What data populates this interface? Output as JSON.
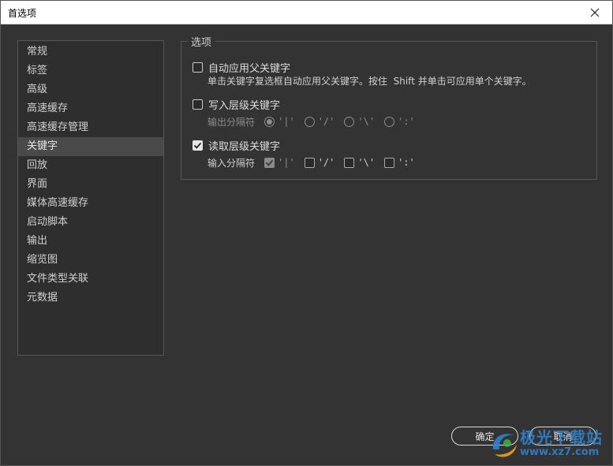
{
  "window": {
    "title": "首选项",
    "close_icon": "close-icon"
  },
  "sidebar": {
    "items": [
      {
        "label": "常规"
      },
      {
        "label": "标签"
      },
      {
        "label": "高级"
      },
      {
        "label": "高速缓存"
      },
      {
        "label": "高速缓存管理"
      },
      {
        "label": "关键字",
        "selected": true
      },
      {
        "label": "回放"
      },
      {
        "label": "界面"
      },
      {
        "label": "媒体高速缓存"
      },
      {
        "label": "启动脚本"
      },
      {
        "label": "输出"
      },
      {
        "label": "缩览图"
      },
      {
        "label": "文件类型关联"
      },
      {
        "label": "元数据"
      }
    ]
  },
  "options": {
    "legend": "选项",
    "auto_parent": {
      "label": "自动应用父关键字",
      "checked": false,
      "description": "单击关键字复选框自动应用父关键字。按住  Shift 并单击可应用单个关键字。"
    },
    "write_hierarchical": {
      "label": "写入层级关键字",
      "checked": false,
      "separator_label": "输出分隔符",
      "separators": [
        "'|'",
        "'/'",
        "'\\'",
        "':'"
      ],
      "selected_separator": "'|'"
    },
    "read_hierarchical": {
      "label": "读取层级关键字",
      "checked": true,
      "separator_label": "输入分隔符",
      "separators": [
        {
          "text": "'|'",
          "checked": true,
          "disabled": true
        },
        {
          "text": "'/'",
          "checked": false
        },
        {
          "text": "'\\'",
          "checked": false
        },
        {
          "text": "':'",
          "checked": false
        }
      ]
    }
  },
  "buttons": {
    "ok": "确定",
    "cancel": "取消"
  },
  "watermark": {
    "line1": "极光下载站",
    "line2": "www.xz7.com"
  },
  "colors": {
    "background": "#333333",
    "titlebar": "#ffffff",
    "selected_item": "#4a4a4a",
    "watermark": "#2f86d6"
  }
}
